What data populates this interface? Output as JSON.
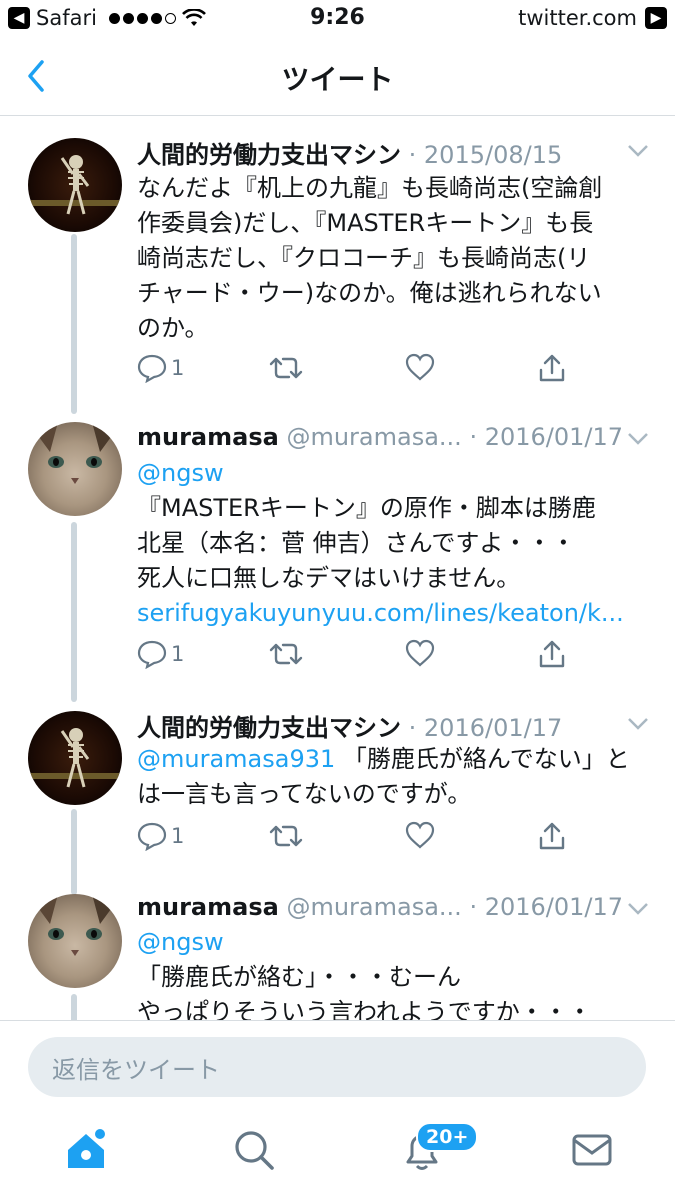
{
  "status_bar": {
    "carrier": "Safari",
    "time": "9:26",
    "site": "twitter.com"
  },
  "nav": {
    "title": "ツイート",
    "back_icon": "chevron-left-icon"
  },
  "tweets": [
    {
      "name": "人間的労働力支出マシン",
      "handle": "",
      "date": "· 2015/08/15",
      "mention": "",
      "lines": [
        "なんだよ『机上の九龍』も長崎尚志(空論創",
        "作委員会)だし、『MASTERキートン』も長",
        "崎尚志だし、『クロコーチ』も長崎尚志(リ",
        "チャード・ウー)なのか。俺は逃れられない",
        "のか。"
      ],
      "link": "",
      "reply_count": "1"
    },
    {
      "name": "muramasa",
      "handle": "@muramasa...",
      "date": "· 2016/01/17",
      "mention": "@ngsw",
      "lines": [
        "『MASTERキートン』の原作・脚本は勝鹿",
        "北星（本名：菅 伸吉）さんですよ・・・",
        "死人に口無しなデマはいけません。"
      ],
      "link": "serifugyakuyunyuu.com/lines/keaton/k...",
      "reply_count": "1"
    },
    {
      "name": "人間的労働力支出マシン",
      "handle": "",
      "date": "· 2016/01/17",
      "mention": "@muramasa931",
      "lines": [
        "「勝鹿氏が絡んでない」と",
        "は一言も言ってないのですが。"
      ],
      "link": "",
      "reply_count": "1"
    },
    {
      "name": "muramasa",
      "handle": "@muramasa...",
      "date": "· 2016/01/17",
      "mention": "@ngsw",
      "lines": [
        "「勝鹿氏が絡む」・・・むーん",
        "やっぱりそういう言われようですか・・・"
      ],
      "link": "",
      "reply_count": ""
    }
  ],
  "reply": {
    "placeholder": "返信をツイート"
  },
  "tabs": {
    "notifications_badge": "20+",
    "icons": [
      "home-icon",
      "search-icon",
      "notifications-icon",
      "messages-icon"
    ]
  },
  "colors": {
    "accent": "#1da1f2",
    "muted": "#8899a6",
    "thread_line": "#ccd6dd"
  }
}
